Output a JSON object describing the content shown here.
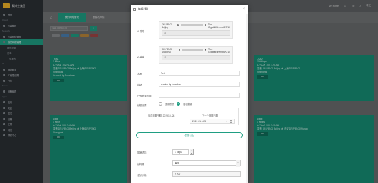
{
  "app": {
    "logo_text": "腾博士集团",
    "topbar": {
      "user": "My Home",
      "lang": "中文"
    }
  },
  "sidebar": {
    "items": [
      {
        "label": "首页",
        "type": "item"
      },
      {
        "label": "Cloud",
        "type": "section"
      },
      {
        "label": "云端管理",
        "type": "item"
      },
      {
        "label": "Network",
        "type": "section"
      },
      {
        "label": "云端网络管理",
        "type": "item"
      },
      {
        "label": "我的网络管理",
        "type": "active"
      },
      {
        "label": "网络设置",
        "type": "sub"
      },
      {
        "label": "订单",
        "type": "sub"
      },
      {
        "label": "工作报表",
        "type": "sub"
      },
      {
        "label": "IP",
        "type": "section"
      },
      {
        "label": "网络服务",
        "type": "item"
      },
      {
        "label": "IP管理设置",
        "type": "item"
      },
      {
        "label": "日志",
        "type": "item"
      },
      {
        "label": "Server",
        "type": "section"
      },
      {
        "label": "设备管理",
        "type": "item"
      },
      {
        "label": "Apps",
        "type": "section"
      },
      {
        "label": "应用",
        "type": "item"
      },
      {
        "label": "安全",
        "type": "item"
      },
      {
        "label": "监控",
        "type": "item"
      },
      {
        "label": "设置",
        "type": "item"
      },
      {
        "label": "工具",
        "type": "item"
      },
      {
        "label": "其他",
        "type": "item"
      },
      {
        "label": "帮助中心",
        "type": "item"
      }
    ]
  },
  "main": {
    "tabs": [
      "我的网络管理",
      "删除的网络"
    ],
    "search": {
      "placeholder": "请输入网络名称"
    },
    "cards": [
      {
        "title": "Test",
        "l1": "1 Mbps",
        "l2": "A-VLAN 10 Z-VLAN",
        "l3": "香港 DR.PENG Beijing ⇄ 上海 DR.PENG",
        "l4": "Shanghai",
        "l5": "Created by Jonathan",
        "btn": "OK"
      },
      {
        "title": "100",
        "l1": "100Mbps",
        "l2": "A-VLAN 100 Z-VLAN",
        "l3": "香港 DR.PENG Beijing ⇄ 上海 DR.PENG",
        "l4": "Shanghai",
        "l5": "",
        "btn": "OK"
      },
      {
        "title": "300",
        "l1": "1 Mbps",
        "l2": "A-VLAN 300 Z-VLAN",
        "l3": "香港 DR.PENG Beijing ⇄ 上海 DR.PENG",
        "l4": "Shanghai",
        "l5": "",
        "btn": "OK"
      },
      {
        "title": "300",
        "l1": "1 Mbps",
        "l2": "A-VLAN 300 Z-VLAN",
        "l3": "香港 DR.PENG Beijing ⇄ 武汉 DR.PENG Wuhan",
        "l4": "",
        "l5": "",
        "btn": "OK"
      }
    ]
  },
  "modal": {
    "title": "编辑线路",
    "a_end": {
      "label": "A-端端",
      "line1_prefix": "DR.PENG Beijing",
      "line1_suffix": "Ten-GigabitEthernet1/0/10",
      "vlan": "10"
    },
    "z_end": {
      "label": "Z-端端",
      "line1_prefix": "DR.PENG Shanghai",
      "line1_suffix": "Ten-GigabitEthernet1/0/10",
      "vlan": "10"
    },
    "name": {
      "label": "名称",
      "value": "Test"
    },
    "desc": {
      "label": "描述",
      "value": "created by Jonathan"
    },
    "auto_renew": {
      "label": "已预购到日期",
      "value": ""
    },
    "billing": {
      "label": "续费设置",
      "opt1": "到期断开",
      "opt2": "自动续费"
    },
    "period": {
      "current_label": "当前到期日期",
      "current_value": "2019-10-24",
      "next_label": "下一个到期日期",
      "next_value": "2019 / 11 / 24"
    },
    "add_button": "保持以上",
    "bandwidth": {
      "label": "带宽选择",
      "value": "1 Mbps"
    },
    "pay_period": {
      "label": "续用期",
      "value": "每月"
    },
    "price": {
      "label": "总价价格",
      "value": "¥ 200"
    }
  }
}
